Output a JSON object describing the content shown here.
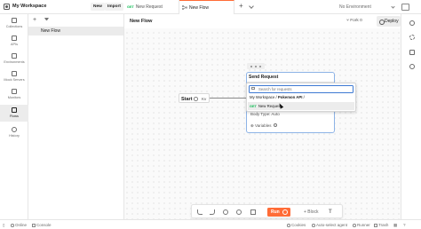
{
  "header": {
    "workspace": "My Workspace",
    "new_label": "New",
    "import_label": "Import",
    "tabs": [
      {
        "method": "GET",
        "label": "New Request"
      },
      {
        "label": "New Flow"
      }
    ],
    "env_label": "No Environment",
    "accent_color": "#ff6c37"
  },
  "leftnav": {
    "items": [
      "Collections",
      "APIs",
      "Environments",
      "Mock Servers",
      "Monitors",
      "Flows",
      "History"
    ],
    "active": "Flows"
  },
  "sidebar": {
    "items": [
      "New Flow"
    ]
  },
  "canvas": {
    "title": "New Flow",
    "fork_label": "Fork",
    "fork_count": "0",
    "deploy_label": "Deploy",
    "start_label": "Start",
    "start_kv": "Kv",
    "send_block": {
      "title": "Send Request",
      "body_type": "Body Type: Auto",
      "variables": "Variables"
    },
    "dropdown": {
      "search_placeholder": "Search for requests",
      "path_prefix": "My Workspace / ",
      "path_collection": "Pokemon API",
      "path_suffix": " /",
      "item_method": "GET",
      "item_label": "New Request"
    }
  },
  "toolbar": {
    "run_label": "Run",
    "block_label": "+ Block",
    "text_label": "T"
  },
  "status": {
    "online": "Online",
    "console": "Console",
    "cookies": "Cookies",
    "auto_select": "Auto-select agent",
    "runner": "Runner",
    "trash": "Trash"
  }
}
